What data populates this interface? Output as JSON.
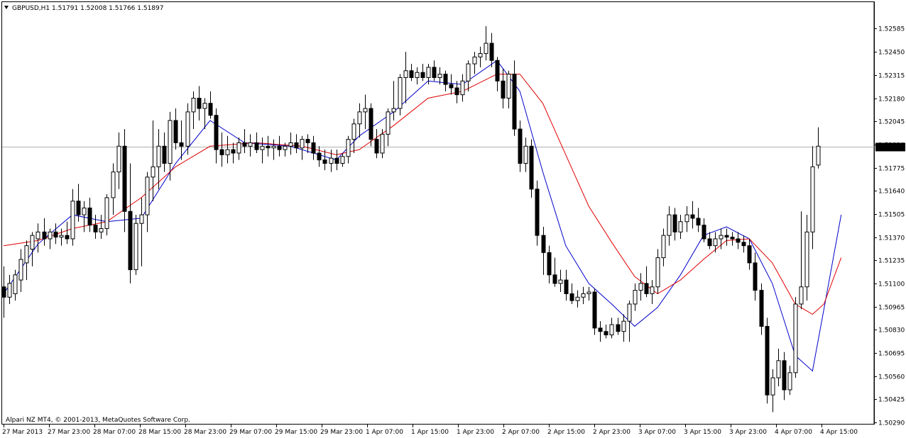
{
  "window": {
    "symbol_header": "GBPUSD,H1  1.51791 1.52008 1.51766 1.51897",
    "watermark": "Alpari NZ MT4, © 2001-2013, MetaQuotes Software Corp."
  },
  "colors": {
    "background": "#ffffff",
    "candle_up_fill": "#ffffff",
    "candle_down_fill": "#000000",
    "ma_fast": "#0000cc",
    "ma_slow": "#e00000",
    "bid_line": "#b0b0b0",
    "price_tag_bg": "#000000",
    "price_tag_text": "#ffffff"
  },
  "chart_data": {
    "type": "candlestick",
    "symbol": "GBPUSD",
    "timeframe": "H1",
    "last_bar": {
      "open": 1.51791,
      "high": 1.52008,
      "low": 1.51766,
      "close": 1.51897
    },
    "current_price_label": "1.51897",
    "y_range": [
      1.5029,
      1.5262
    ],
    "y_ticks": [
      "1.52585",
      "1.52450",
      "1.52315",
      "1.52180",
      "1.52045",
      "1.51910",
      "1.51775",
      "1.51640",
      "1.51505",
      "1.51370",
      "1.51235",
      "1.51100",
      "1.50965",
      "1.50830",
      "1.50695",
      "1.50560",
      "1.50425",
      "1.50290"
    ],
    "x_ticks": [
      "27 Mar 2013",
      "27 Mar 23:00",
      "28 Mar 07:00",
      "28 Mar 15:00",
      "28 Mar 23:00",
      "29 Mar 07:00",
      "29 Mar 15:00",
      "29 Mar 23:00",
      "1 Apr 07:00",
      "1 Apr 15:00",
      "1 Apr 23:00",
      "2 Apr 07:00",
      "2 Apr 15:00",
      "2 Apr 23:00",
      "3 Apr 07:00",
      "3 Apr 15:00",
      "3 Apr 23:00",
      "4 Apr 07:00",
      "4 Apr 15:00"
    ],
    "grid": false,
    "candles": [
      {
        "o": 1.5108,
        "h": 1.512,
        "l": 1.509,
        "c": 1.5102
      },
      {
        "o": 1.5102,
        "h": 1.5115,
        "l": 1.5098,
        "c": 1.511
      },
      {
        "o": 1.5104,
        "h": 1.5118,
        "l": 1.51,
        "c": 1.5115
      },
      {
        "o": 1.5112,
        "h": 1.513,
        "l": 1.5105,
        "c": 1.5124
      },
      {
        "o": 1.5122,
        "h": 1.5135,
        "l": 1.5112,
        "c": 1.5132
      },
      {
        "o": 1.513,
        "h": 1.514,
        "l": 1.512,
        "c": 1.5138
      },
      {
        "o": 1.5136,
        "h": 1.5145,
        "l": 1.5128,
        "c": 1.514
      },
      {
        "o": 1.514,
        "h": 1.5148,
        "l": 1.5132,
        "c": 1.5136
      },
      {
        "o": 1.5136,
        "h": 1.5142,
        "l": 1.513,
        "c": 1.514
      },
      {
        "o": 1.514,
        "h": 1.5145,
        "l": 1.5133,
        "c": 1.5137
      },
      {
        "o": 1.5137,
        "h": 1.5142,
        "l": 1.5132,
        "c": 1.5138
      },
      {
        "o": 1.5138,
        "h": 1.5146,
        "l": 1.5133,
        "c": 1.5136
      },
      {
        "o": 1.5136,
        "h": 1.5165,
        "l": 1.5132,
        "c": 1.5158
      },
      {
        "o": 1.5158,
        "h": 1.5168,
        "l": 1.5146,
        "c": 1.515
      },
      {
        "o": 1.515,
        "h": 1.5158,
        "l": 1.514,
        "c": 1.5154
      },
      {
        "o": 1.5154,
        "h": 1.516,
        "l": 1.514,
        "c": 1.5144
      },
      {
        "o": 1.5144,
        "h": 1.515,
        "l": 1.5136,
        "c": 1.514
      },
      {
        "o": 1.514,
        "h": 1.515,
        "l": 1.5136,
        "c": 1.5142
      },
      {
        "o": 1.5142,
        "h": 1.5162,
        "l": 1.5138,
        "c": 1.516
      },
      {
        "o": 1.516,
        "h": 1.518,
        "l": 1.515,
        "c": 1.5175
      },
      {
        "o": 1.5175,
        "h": 1.5198,
        "l": 1.5165,
        "c": 1.519
      },
      {
        "o": 1.519,
        "h": 1.52,
        "l": 1.514,
        "c": 1.5152
      },
      {
        "o": 1.5152,
        "h": 1.518,
        "l": 1.511,
        "c": 1.5118
      },
      {
        "o": 1.5118,
        "h": 1.515,
        "l": 1.5115,
        "c": 1.5145
      },
      {
        "o": 1.5145,
        "h": 1.516,
        "l": 1.512,
        "c": 1.515
      },
      {
        "o": 1.515,
        "h": 1.5175,
        "l": 1.514,
        "c": 1.5172
      },
      {
        "o": 1.5172,
        "h": 1.5205,
        "l": 1.5158,
        "c": 1.5178
      },
      {
        "o": 1.5178,
        "h": 1.52,
        "l": 1.5165,
        "c": 1.519
      },
      {
        "o": 1.519,
        "h": 1.5198,
        "l": 1.5175,
        "c": 1.518
      },
      {
        "o": 1.518,
        "h": 1.521,
        "l": 1.517,
        "c": 1.5205
      },
      {
        "o": 1.5205,
        "h": 1.5212,
        "l": 1.5188,
        "c": 1.5192
      },
      {
        "o": 1.5192,
        "h": 1.5205,
        "l": 1.5182,
        "c": 1.519
      },
      {
        "o": 1.519,
        "h": 1.5215,
        "l": 1.5185,
        "c": 1.521
      },
      {
        "o": 1.521,
        "h": 1.5222,
        "l": 1.52,
        "c": 1.5218
      },
      {
        "o": 1.5218,
        "h": 1.5225,
        "l": 1.5205,
        "c": 1.5212
      },
      {
        "o": 1.5212,
        "h": 1.5218,
        "l": 1.52,
        "c": 1.5215
      },
      {
        "o": 1.5215,
        "h": 1.5222,
        "l": 1.5206,
        "c": 1.5208
      },
      {
        "o": 1.5208,
        "h": 1.5212,
        "l": 1.518,
        "c": 1.5188
      },
      {
        "o": 1.5188,
        "h": 1.5198,
        "l": 1.5178,
        "c": 1.5185
      },
      {
        "o": 1.5185,
        "h": 1.5196,
        "l": 1.518,
        "c": 1.5188
      },
      {
        "o": 1.5188,
        "h": 1.5192,
        "l": 1.518,
        "c": 1.5186
      },
      {
        "o": 1.5186,
        "h": 1.5195,
        "l": 1.5182,
        "c": 1.5192
      },
      {
        "o": 1.5192,
        "h": 1.52,
        "l": 1.5186,
        "c": 1.519
      },
      {
        "o": 1.519,
        "h": 1.5197,
        "l": 1.5184,
        "c": 1.5192
      },
      {
        "o": 1.5192,
        "h": 1.5198,
        "l": 1.5186,
        "c": 1.5188
      },
      {
        "o": 1.5188,
        "h": 1.5195,
        "l": 1.518,
        "c": 1.519
      },
      {
        "o": 1.519,
        "h": 1.5196,
        "l": 1.5184,
        "c": 1.5189
      },
      {
        "o": 1.5189,
        "h": 1.5194,
        "l": 1.5182,
        "c": 1.519
      },
      {
        "o": 1.519,
        "h": 1.5196,
        "l": 1.5184,
        "c": 1.5188
      },
      {
        "o": 1.5188,
        "h": 1.5192,
        "l": 1.5184,
        "c": 1.519
      },
      {
        "o": 1.519,
        "h": 1.5198,
        "l": 1.5185,
        "c": 1.5192
      },
      {
        "o": 1.5192,
        "h": 1.5197,
        "l": 1.5186,
        "c": 1.5189
      },
      {
        "o": 1.5189,
        "h": 1.5196,
        "l": 1.5182,
        "c": 1.5194
      },
      {
        "o": 1.5194,
        "h": 1.5197,
        "l": 1.5186,
        "c": 1.5192
      },
      {
        "o": 1.5192,
        "h": 1.5196,
        "l": 1.5182,
        "c": 1.5186
      },
      {
        "o": 1.5186,
        "h": 1.519,
        "l": 1.5178,
        "c": 1.5182
      },
      {
        "o": 1.5182,
        "h": 1.5188,
        "l": 1.5176,
        "c": 1.518
      },
      {
        "o": 1.518,
        "h": 1.5188,
        "l": 1.5175,
        "c": 1.5183
      },
      {
        "o": 1.5183,
        "h": 1.5188,
        "l": 1.5176,
        "c": 1.518
      },
      {
        "o": 1.518,
        "h": 1.5186,
        "l": 1.5178,
        "c": 1.5184
      },
      {
        "o": 1.5184,
        "h": 1.5196,
        "l": 1.518,
        "c": 1.5194
      },
      {
        "o": 1.5194,
        "h": 1.5206,
        "l": 1.5186,
        "c": 1.5203
      },
      {
        "o": 1.5203,
        "h": 1.5215,
        "l": 1.5195,
        "c": 1.521
      },
      {
        "o": 1.521,
        "h": 1.522,
        "l": 1.52,
        "c": 1.5212
      },
      {
        "o": 1.5212,
        "h": 1.5215,
        "l": 1.519,
        "c": 1.5194
      },
      {
        "o": 1.5194,
        "h": 1.52,
        "l": 1.5183,
        "c": 1.5186
      },
      {
        "o": 1.5186,
        "h": 1.52,
        "l": 1.5183,
        "c": 1.5197
      },
      {
        "o": 1.5197,
        "h": 1.5212,
        "l": 1.519,
        "c": 1.521
      },
      {
        "o": 1.521,
        "h": 1.5228,
        "l": 1.5205,
        "c": 1.5212
      },
      {
        "o": 1.5212,
        "h": 1.5232,
        "l": 1.5208,
        "c": 1.523
      },
      {
        "o": 1.523,
        "h": 1.5245,
        "l": 1.5215,
        "c": 1.5234
      },
      {
        "o": 1.5234,
        "h": 1.5238,
        "l": 1.5228,
        "c": 1.523
      },
      {
        "o": 1.523,
        "h": 1.5236,
        "l": 1.5226,
        "c": 1.5233
      },
      {
        "o": 1.5233,
        "h": 1.5238,
        "l": 1.5228,
        "c": 1.523
      },
      {
        "o": 1.523,
        "h": 1.5238,
        "l": 1.5226,
        "c": 1.5236
      },
      {
        "o": 1.5236,
        "h": 1.524,
        "l": 1.5228,
        "c": 1.523
      },
      {
        "o": 1.523,
        "h": 1.5236,
        "l": 1.5226,
        "c": 1.5232
      },
      {
        "o": 1.5232,
        "h": 1.5234,
        "l": 1.5222,
        "c": 1.5226
      },
      {
        "o": 1.5226,
        "h": 1.5232,
        "l": 1.522,
        "c": 1.5224
      },
      {
        "o": 1.5224,
        "h": 1.5228,
        "l": 1.5215,
        "c": 1.522
      },
      {
        "o": 1.522,
        "h": 1.5232,
        "l": 1.5216,
        "c": 1.5228
      },
      {
        "o": 1.5228,
        "h": 1.524,
        "l": 1.5222,
        "c": 1.5238
      },
      {
        "o": 1.5238,
        "h": 1.5245,
        "l": 1.5232,
        "c": 1.5242
      },
      {
        "o": 1.5242,
        "h": 1.5248,
        "l": 1.5236,
        "c": 1.5244
      },
      {
        "o": 1.5244,
        "h": 1.526,
        "l": 1.524,
        "c": 1.525
      },
      {
        "o": 1.525,
        "h": 1.5256,
        "l": 1.5236,
        "c": 1.524
      },
      {
        "o": 1.524,
        "h": 1.5242,
        "l": 1.5222,
        "c": 1.5228
      },
      {
        "o": 1.5228,
        "h": 1.5235,
        "l": 1.5212,
        "c": 1.5218
      },
      {
        "o": 1.5218,
        "h": 1.5234,
        "l": 1.5212,
        "c": 1.5232
      },
      {
        "o": 1.5232,
        "h": 1.524,
        "l": 1.5196,
        "c": 1.52
      },
      {
        "o": 1.52,
        "h": 1.5205,
        "l": 1.5175,
        "c": 1.518
      },
      {
        "o": 1.518,
        "h": 1.5195,
        "l": 1.5175,
        "c": 1.519
      },
      {
        "o": 1.519,
        "h": 1.5194,
        "l": 1.516,
        "c": 1.5165
      },
      {
        "o": 1.5165,
        "h": 1.517,
        "l": 1.5132,
        "c": 1.5138
      },
      {
        "o": 1.5138,
        "h": 1.5143,
        "l": 1.5115,
        "c": 1.5128
      },
      {
        "o": 1.5128,
        "h": 1.5132,
        "l": 1.511,
        "c": 1.5115
      },
      {
        "o": 1.5115,
        "h": 1.5125,
        "l": 1.5108,
        "c": 1.511
      },
      {
        "o": 1.511,
        "h": 1.5118,
        "l": 1.5105,
        "c": 1.5112
      },
      {
        "o": 1.5112,
        "h": 1.5118,
        "l": 1.51,
        "c": 1.5104
      },
      {
        "o": 1.5104,
        "h": 1.511,
        "l": 1.5098,
        "c": 1.51
      },
      {
        "o": 1.51,
        "h": 1.5106,
        "l": 1.5096,
        "c": 1.5102
      },
      {
        "o": 1.5102,
        "h": 1.5108,
        "l": 1.5098,
        "c": 1.5104
      },
      {
        "o": 1.5104,
        "h": 1.5108,
        "l": 1.51,
        "c": 1.5105
      },
      {
        "o": 1.5105,
        "h": 1.5107,
        "l": 1.508,
        "c": 1.5084
      },
      {
        "o": 1.5084,
        "h": 1.5088,
        "l": 1.5076,
        "c": 1.5082
      },
      {
        "o": 1.5082,
        "h": 1.5086,
        "l": 1.5078,
        "c": 1.508
      },
      {
        "o": 1.508,
        "h": 1.509,
        "l": 1.5078,
        "c": 1.5086
      },
      {
        "o": 1.5086,
        "h": 1.509,
        "l": 1.508,
        "c": 1.5082
      },
      {
        "o": 1.5082,
        "h": 1.5092,
        "l": 1.5076,
        "c": 1.5088
      },
      {
        "o": 1.5088,
        "h": 1.51,
        "l": 1.5076,
        "c": 1.5098
      },
      {
        "o": 1.5098,
        "h": 1.511,
        "l": 1.5094,
        "c": 1.5106
      },
      {
        "o": 1.5106,
        "h": 1.5116,
        "l": 1.51,
        "c": 1.511
      },
      {
        "o": 1.511,
        "h": 1.512,
        "l": 1.5102,
        "c": 1.5104
      },
      {
        "o": 1.5104,
        "h": 1.5112,
        "l": 1.5098,
        "c": 1.5108
      },
      {
        "o": 1.5108,
        "h": 1.513,
        "l": 1.5104,
        "c": 1.5125
      },
      {
        "o": 1.5125,
        "h": 1.5142,
        "l": 1.512,
        "c": 1.5138
      },
      {
        "o": 1.5138,
        "h": 1.5155,
        "l": 1.5132,
        "c": 1.515
      },
      {
        "o": 1.515,
        "h": 1.5154,
        "l": 1.5135,
        "c": 1.514
      },
      {
        "o": 1.514,
        "h": 1.515,
        "l": 1.5136,
        "c": 1.5146
      },
      {
        "o": 1.5146,
        "h": 1.5155,
        "l": 1.514,
        "c": 1.515
      },
      {
        "o": 1.515,
        "h": 1.5158,
        "l": 1.5142,
        "c": 1.5148
      },
      {
        "o": 1.5148,
        "h": 1.5154,
        "l": 1.514,
        "c": 1.5144
      },
      {
        "o": 1.5144,
        "h": 1.5148,
        "l": 1.5134,
        "c": 1.5136
      },
      {
        "o": 1.5136,
        "h": 1.514,
        "l": 1.513,
        "c": 1.5132
      },
      {
        "o": 1.5132,
        "h": 1.514,
        "l": 1.5128,
        "c": 1.5136
      },
      {
        "o": 1.5136,
        "h": 1.5142,
        "l": 1.513,
        "c": 1.5138
      },
      {
        "o": 1.5138,
        "h": 1.5142,
        "l": 1.5132,
        "c": 1.5137
      },
      {
        "o": 1.5137,
        "h": 1.514,
        "l": 1.5132,
        "c": 1.5136
      },
      {
        "o": 1.5136,
        "h": 1.514,
        "l": 1.513,
        "c": 1.5134
      },
      {
        "o": 1.5134,
        "h": 1.5138,
        "l": 1.5128,
        "c": 1.5132
      },
      {
        "o": 1.5132,
        "h": 1.5136,
        "l": 1.5118,
        "c": 1.5122
      },
      {
        "o": 1.5122,
        "h": 1.5128,
        "l": 1.51,
        "c": 1.5106
      },
      {
        "o": 1.5106,
        "h": 1.511,
        "l": 1.508,
        "c": 1.5085
      },
      {
        "o": 1.5085,
        "h": 1.509,
        "l": 1.504,
        "c": 1.5045
      },
      {
        "o": 1.5045,
        "h": 1.506,
        "l": 1.5035,
        "c": 1.5055
      },
      {
        "o": 1.5055,
        "h": 1.5072,
        "l": 1.505,
        "c": 1.5065
      },
      {
        "o": 1.5065,
        "h": 1.507,
        "l": 1.5042,
        "c": 1.5048
      },
      {
        "o": 1.5048,
        "h": 1.5062,
        "l": 1.5045,
        "c": 1.5058
      },
      {
        "o": 1.5058,
        "h": 1.5102,
        "l": 1.5055,
        "c": 1.5098
      },
      {
        "o": 1.5098,
        "h": 1.5152,
        "l": 1.5095,
        "c": 1.5108
      },
      {
        "o": 1.5108,
        "h": 1.515,
        "l": 1.51,
        "c": 1.514
      },
      {
        "o": 1.514,
        "h": 1.519,
        "l": 1.513,
        "c": 1.5178
      },
      {
        "o": 1.5179,
        "h": 1.5201,
        "l": 1.5177,
        "c": 1.519
      }
    ],
    "indicators": [
      {
        "type": "moving_average",
        "color": "#0000cc",
        "points": [
          [
            0,
            1.5104
          ],
          [
            6,
            1.5133
          ],
          [
            12,
            1.515
          ],
          [
            18,
            1.5146
          ],
          [
            24,
            1.5148
          ],
          [
            30,
            1.518
          ],
          [
            36,
            1.5205
          ],
          [
            42,
            1.5192
          ],
          [
            50,
            1.519
          ],
          [
            58,
            1.5182
          ],
          [
            62,
            1.5196
          ],
          [
            68,
            1.521
          ],
          [
            74,
            1.5228
          ],
          [
            80,
            1.5226
          ],
          [
            86,
            1.524
          ],
          [
            90,
            1.5222
          ],
          [
            94,
            1.5175
          ],
          [
            98,
            1.5132
          ],
          [
            102,
            1.511
          ],
          [
            106,
            1.5098
          ],
          [
            110,
            1.5085
          ],
          [
            114,
            1.5096
          ],
          [
            118,
            1.5115
          ],
          [
            122,
            1.5138
          ],
          [
            126,
            1.5143
          ],
          [
            130,
            1.5136
          ],
          [
            134,
            1.511
          ],
          [
            138,
            1.5068
          ],
          [
            141,
            1.5059
          ],
          [
            143,
            1.5095
          ],
          [
            146,
            1.515
          ]
        ]
      },
      {
        "type": "moving_average",
        "color": "#e00000",
        "points": [
          [
            0,
            1.5132
          ],
          [
            6,
            1.5135
          ],
          [
            12,
            1.5142
          ],
          [
            18,
            1.5146
          ],
          [
            24,
            1.516
          ],
          [
            30,
            1.5178
          ],
          [
            36,
            1.519
          ],
          [
            44,
            1.5192
          ],
          [
            52,
            1.519
          ],
          [
            58,
            1.5185
          ],
          [
            62,
            1.5188
          ],
          [
            68,
            1.5202
          ],
          [
            74,
            1.5218
          ],
          [
            80,
            1.5222
          ],
          [
            86,
            1.5232
          ],
          [
            90,
            1.5232
          ],
          [
            94,
            1.5215
          ],
          [
            98,
            1.5185
          ],
          [
            102,
            1.5155
          ],
          [
            106,
            1.5134
          ],
          [
            110,
            1.5114
          ],
          [
            114,
            1.5104
          ],
          [
            118,
            1.5112
          ],
          [
            122,
            1.5124
          ],
          [
            126,
            1.5135
          ],
          [
            130,
            1.5136
          ],
          [
            134,
            1.5122
          ],
          [
            138,
            1.5098
          ],
          [
            141,
            1.5092
          ],
          [
            143,
            1.5098
          ],
          [
            146,
            1.5125
          ]
        ]
      }
    ]
  }
}
